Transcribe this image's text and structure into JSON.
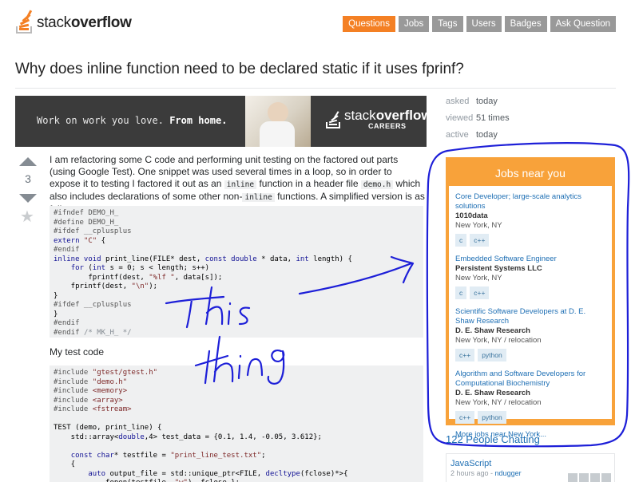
{
  "header": {
    "logo_light": "stack",
    "logo_bold": "overflow",
    "nav": [
      {
        "label": "Questions",
        "active": true
      },
      {
        "label": "Jobs",
        "active": false
      },
      {
        "label": "Tags",
        "active": false
      },
      {
        "label": "Users",
        "active": false
      },
      {
        "label": "Badges",
        "active": false
      },
      {
        "label": "Ask Question",
        "active": false
      }
    ]
  },
  "question": {
    "title": "Why does inline function need to be declared static if it uses fprinf?",
    "votes": "3",
    "body_pre": "I am refactoring some C code and performing unit testing on the factored out parts (using Google Test). One snippet was used several times in a loop, so in order to expose it to testing I factored it out as an ",
    "body_code1": "inline",
    "body_mid": " function in a header file ",
    "body_code2": "demo.h",
    "body_mid2": " which also includes declarations of some other non-",
    "body_code3": "inline",
    "body_post": " functions. A simplified version is as follows:",
    "my_test_code": "My test code"
  },
  "banner": {
    "text_plain": "Work on work you love.",
    "text_bold": "From home.",
    "logo_light": "stack",
    "logo_bold": "overflow",
    "logo_sub": "CAREERS"
  },
  "stats": {
    "asked_label": "asked",
    "asked_value": "today",
    "viewed_label": "viewed",
    "viewed_value": "51 times",
    "active_label": "active",
    "active_value": "today"
  },
  "jobs": {
    "title": "Jobs near you",
    "items": [
      {
        "title": "Core Developer; large-scale analytics solutions",
        "company": "1010data",
        "location": "New York, NY",
        "tags": [
          "c",
          "c++"
        ]
      },
      {
        "title": "Embedded Software Engineer",
        "company": "Persistent Systems LLC",
        "location": "New York, NY",
        "tags": [
          "c",
          "c++"
        ]
      },
      {
        "title": "Scientific Software Developers at D. E. Shaw Research",
        "company": "D. E. Shaw Research",
        "location": "New York, NY / relocation",
        "tags": [
          "c++",
          "python"
        ]
      },
      {
        "title": "Algorithm and Software Developers for Computational Biochemistry",
        "company": "D. E. Shaw Research",
        "location": "New York, NY / relocation",
        "tags": [
          "c++",
          "python"
        ]
      }
    ],
    "more": "More jobs near New York..."
  },
  "chat": {
    "heading": "122 People Chatting",
    "room": "JavaScript",
    "meta_time": "2 hours ago - ",
    "meta_user": "ndugger"
  },
  "annotation": {
    "word1": "This",
    "word2": "thing",
    "color": "#1d1fd8"
  },
  "colors": {
    "brand": "#f48024",
    "nav_inactive": "#999999",
    "jobs_frame": "#f8a23a",
    "link": "#1e6fb4"
  }
}
